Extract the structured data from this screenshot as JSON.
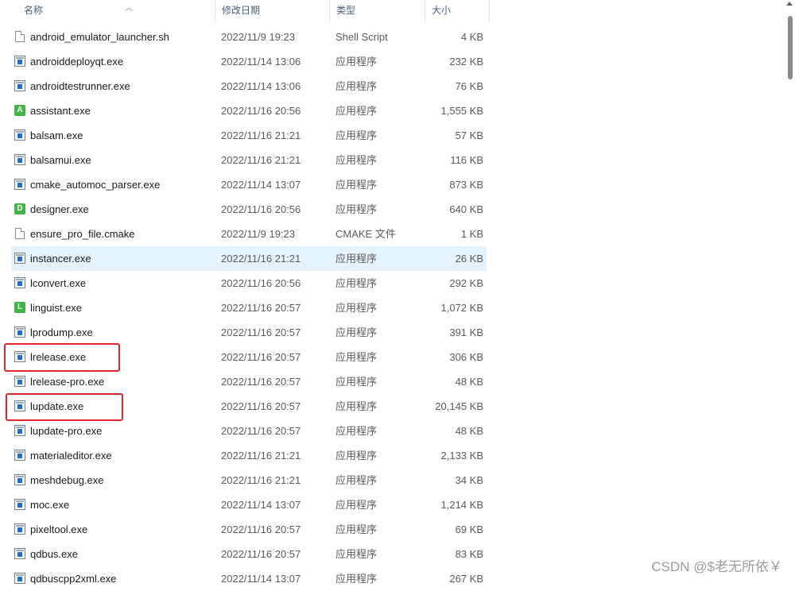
{
  "header": {
    "col_name": "名称",
    "col_date": "修改日期",
    "col_type": "类型",
    "col_size": "大小"
  },
  "files": [
    {
      "name": "android_emulator_launcher.sh",
      "date": "2022/11/9 19:23",
      "type": "Shell Script",
      "size": "4 KB",
      "icon": "document-icon"
    },
    {
      "name": "androiddeployqt.exe",
      "date": "2022/11/14 13:06",
      "type": "应用程序",
      "size": "232 KB",
      "icon": "exe-icon"
    },
    {
      "name": "androidtestrunner.exe",
      "date": "2022/11/14 13:06",
      "type": "应用程序",
      "size": "76 KB",
      "icon": "exe-icon"
    },
    {
      "name": "assistant.exe",
      "date": "2022/11/16 20:56",
      "type": "应用程序",
      "size": "1,555 KB",
      "icon": "qt-assistant-icon"
    },
    {
      "name": "balsam.exe",
      "date": "2022/11/16 21:21",
      "type": "应用程序",
      "size": "57 KB",
      "icon": "exe-icon"
    },
    {
      "name": "balsamui.exe",
      "date": "2022/11/16 21:21",
      "type": "应用程序",
      "size": "116 KB",
      "icon": "exe-icon"
    },
    {
      "name": "cmake_automoc_parser.exe",
      "date": "2022/11/14 13:07",
      "type": "应用程序",
      "size": "873 KB",
      "icon": "exe-icon"
    },
    {
      "name": "designer.exe",
      "date": "2022/11/16 20:56",
      "type": "应用程序",
      "size": "640 KB",
      "icon": "qt-designer-icon"
    },
    {
      "name": "ensure_pro_file.cmake",
      "date": "2022/11/9 19:23",
      "type": "CMAKE 文件",
      "size": "1 KB",
      "icon": "document-icon"
    },
    {
      "name": "instancer.exe",
      "date": "2022/11/16 21:21",
      "type": "应用程序",
      "size": "26 KB",
      "icon": "exe-icon",
      "selected": true
    },
    {
      "name": "lconvert.exe",
      "date": "2022/11/16 20:56",
      "type": "应用程序",
      "size": "292 KB",
      "icon": "exe-icon"
    },
    {
      "name": "linguist.exe",
      "date": "2022/11/16 20:57",
      "type": "应用程序",
      "size": "1,072 KB",
      "icon": "qt-linguist-icon"
    },
    {
      "name": "lprodump.exe",
      "date": "2022/11/16 20:57",
      "type": "应用程序",
      "size": "391 KB",
      "icon": "exe-icon"
    },
    {
      "name": "lrelease.exe",
      "date": "2022/11/16 20:57",
      "type": "应用程序",
      "size": "306 KB",
      "icon": "exe-icon"
    },
    {
      "name": "lrelease-pro.exe",
      "date": "2022/11/16 20:57",
      "type": "应用程序",
      "size": "48 KB",
      "icon": "exe-icon"
    },
    {
      "name": "lupdate.exe",
      "date": "2022/11/16 20:57",
      "type": "应用程序",
      "size": "20,145 KB",
      "icon": "exe-icon"
    },
    {
      "name": "lupdate-pro.exe",
      "date": "2022/11/16 20:57",
      "type": "应用程序",
      "size": "48 KB",
      "icon": "exe-icon"
    },
    {
      "name": "materialeditor.exe",
      "date": "2022/11/16 21:21",
      "type": "应用程序",
      "size": "2,133 KB",
      "icon": "exe-icon"
    },
    {
      "name": "meshdebug.exe",
      "date": "2022/11/16 21:21",
      "type": "应用程序",
      "size": "34 KB",
      "icon": "exe-icon"
    },
    {
      "name": "moc.exe",
      "date": "2022/11/14 13:07",
      "type": "应用程序",
      "size": "1,214 KB",
      "icon": "exe-icon"
    },
    {
      "name": "pixeltool.exe",
      "date": "2022/11/16 20:57",
      "type": "应用程序",
      "size": "69 KB",
      "icon": "exe-icon"
    },
    {
      "name": "qdbus.exe",
      "date": "2022/11/16 20:57",
      "type": "应用程序",
      "size": "83 KB",
      "icon": "exe-icon"
    },
    {
      "name": "qdbuscpp2xml.exe",
      "date": "2022/11/14 13:07",
      "type": "应用程序",
      "size": "267 KB",
      "icon": "exe-icon"
    }
  ],
  "highlight_color": "#e3262b",
  "selection_color": "#e5f3ff",
  "watermark": "CSDN @$老无所依￥"
}
